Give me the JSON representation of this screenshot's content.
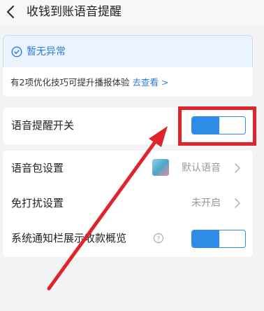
{
  "header": {
    "title": "收钱到账语音提醒"
  },
  "notice": {
    "status": "暂无异常",
    "tip": "有2项优化技巧可提升播报体验",
    "link": "去查看 >"
  },
  "settings": {
    "voice_reminder": {
      "label": "语音提醒开关",
      "enabled": true
    },
    "voice_pack": {
      "label": "语音包设置",
      "value": "默认语音"
    },
    "do_not_disturb": {
      "label": "免打扰设置",
      "value": "未开启"
    },
    "notification_overview": {
      "label": "系统通知栏展示收款概览",
      "enabled": true
    }
  },
  "colors": {
    "accent": "#2f8ce6",
    "highlight": "#e0242b",
    "link": "#2f7be0"
  },
  "icons": [
    "back-arrow-icon",
    "check-circle-icon",
    "chevron-right-icon",
    "help-icon",
    "voice-pack-thumbnail"
  ]
}
